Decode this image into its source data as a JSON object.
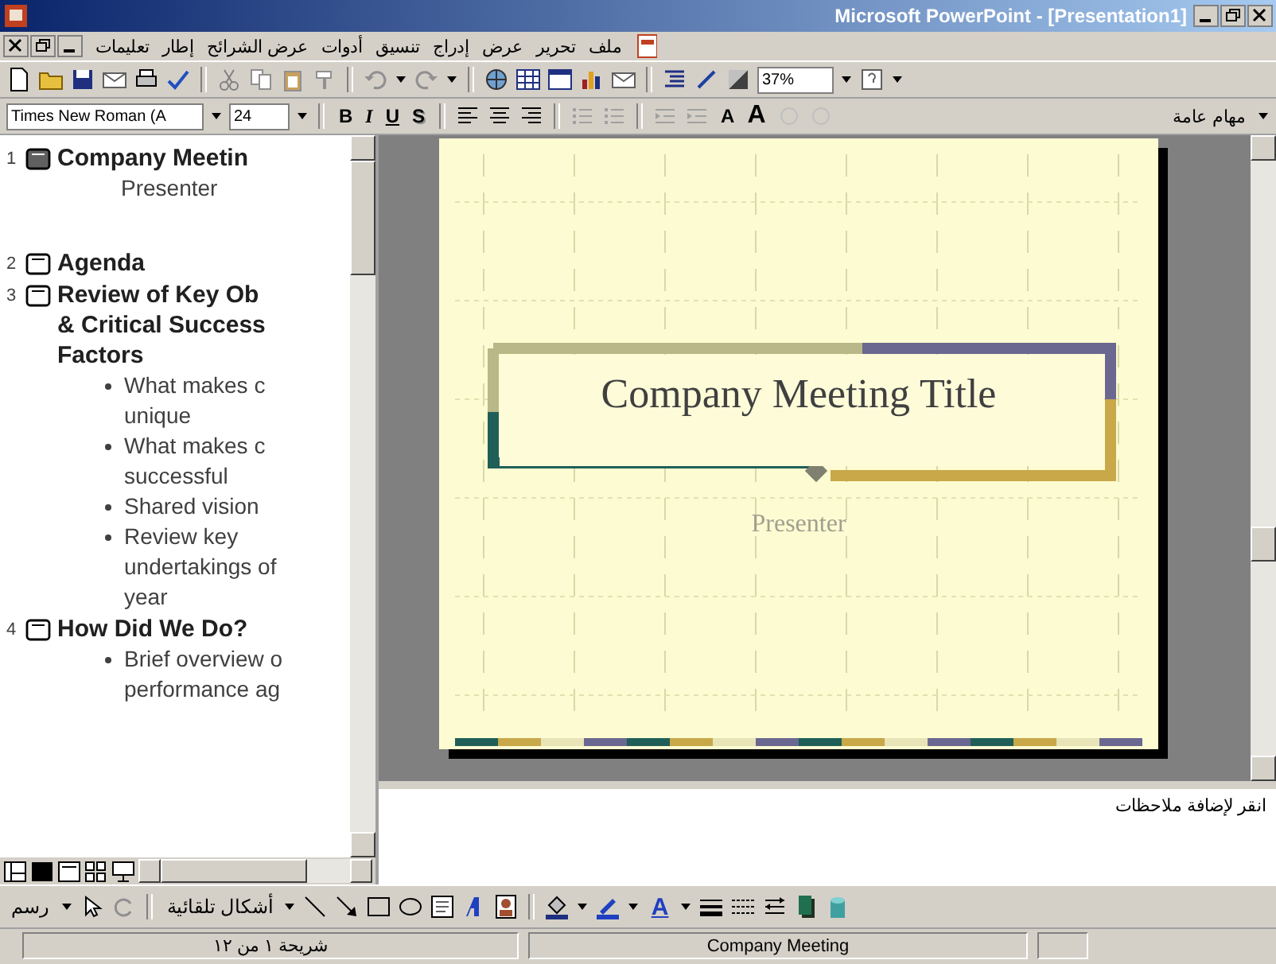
{
  "window": {
    "title": "Microsoft PowerPoint - [Presentation1]"
  },
  "menu": [
    "ملف",
    "تحرير",
    "عرض",
    "إدراج",
    "تنسيق",
    "أدوات",
    "عرض الشرائح",
    "إطار",
    "تعليمات"
  ],
  "standard_toolbar": {
    "zoom": "37%"
  },
  "formatting_toolbar": {
    "font": "Times New Roman (A",
    "size": "24",
    "style_buttons": [
      "S",
      "U",
      "I",
      "B"
    ],
    "font_size_buttons": [
      "A",
      "A"
    ],
    "tasks": "مهام عامة"
  },
  "outline": [
    {
      "number": "1",
      "title_lines": [
        "Company Meetin"
      ],
      "selected": true,
      "subtitle": "Presenter"
    },
    {
      "number": "2",
      "title_lines": [
        "Agenda"
      ],
      "selected": false
    },
    {
      "number": "3",
      "title_lines": [
        "Review of Key Ob",
        "& Critical Success",
        "Factors"
      ],
      "selected": false,
      "children": [
        {
          "lines": [
            "What makes c",
            "unique"
          ]
        },
        {
          "lines": [
            "What makes c",
            "successful"
          ]
        },
        {
          "lines": [
            "Shared vision"
          ]
        },
        {
          "lines": [
            "Review key",
            "undertakings of",
            "year"
          ]
        }
      ]
    },
    {
      "number": "4",
      "title_lines": [
        "How Did We Do?"
      ],
      "selected": false,
      "children": [
        {
          "lines": [
            "Brief overview o",
            "performance ag"
          ]
        }
      ]
    }
  ],
  "slide": {
    "title": "Company Meeting Title",
    "subtitle": "Presenter"
  },
  "notes": {
    "placeholder": "انقر لإضافة ملاحظات"
  },
  "drawing_toolbar": {
    "draw_menu": "رسم",
    "autoshapes_menu": "أشكال تلقائية",
    "font_color": "A"
  },
  "status_bar": [
    "Company Meeting",
    "شريحة ١ من ١٢"
  ]
}
